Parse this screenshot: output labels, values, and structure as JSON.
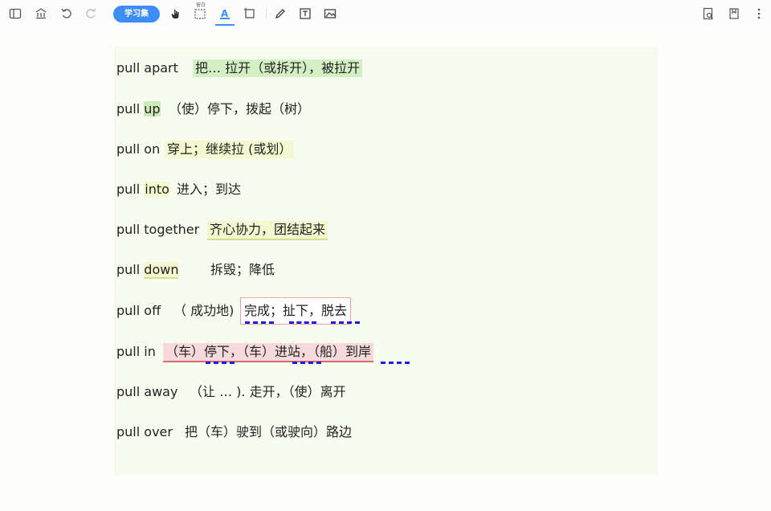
{
  "toolbar": {
    "study_set_label": "学习集",
    "small_label": "留白",
    "icons": [
      "sidebar-toggle-icon",
      "library-icon",
      "undo-icon",
      "redo-icon",
      "hand-icon",
      "whitespace-icon",
      "highlight-text-icon",
      "rect-select-icon",
      "pen-icon",
      "text-box-icon",
      "image-icon",
      "search-doc-icon",
      "bookmark-icon",
      "more-icon"
    ]
  },
  "rows": [
    {
      "phrase": "pull apart",
      "meaning": "把… 拉开（或拆开），被拉开"
    },
    {
      "phrase_a": "pull ",
      "phrase_b": "up",
      "meaning": "（使）停下，拨起（树）"
    },
    {
      "phrase": "pull on",
      "meaning": "穿上；继续拉 (或划）"
    },
    {
      "phrase_a": "pull ",
      "phrase_b": "into",
      "meaning": "进入；到达"
    },
    {
      "phrase": "pull together",
      "meaning": "齐心协力，团结起来"
    },
    {
      "phrase_a": "pull ",
      "phrase_b": "down",
      "meaning": "拆毁；降低"
    },
    {
      "phrase": "pull off",
      "note": "（ 成功地)",
      "meaning": "完成；扯下，脱去"
    },
    {
      "phrase": "pull in",
      "meaning": "（车）停下，（车）进站，（船）到岸"
    },
    {
      "phrase": "pull away",
      "meaning": "（让 … ). 走开，（使）离开"
    },
    {
      "phrase": "pull over",
      "meaning": "把（车）驶到（或驶向）路边"
    }
  ],
  "colors": {
    "accent": "#3d8df5",
    "highlight_green": "#d5efc4",
    "highlight_yellow": "#f4f8cf",
    "highlight_pink": "#f6d9da",
    "dash_blue": "#1f1fd6"
  }
}
